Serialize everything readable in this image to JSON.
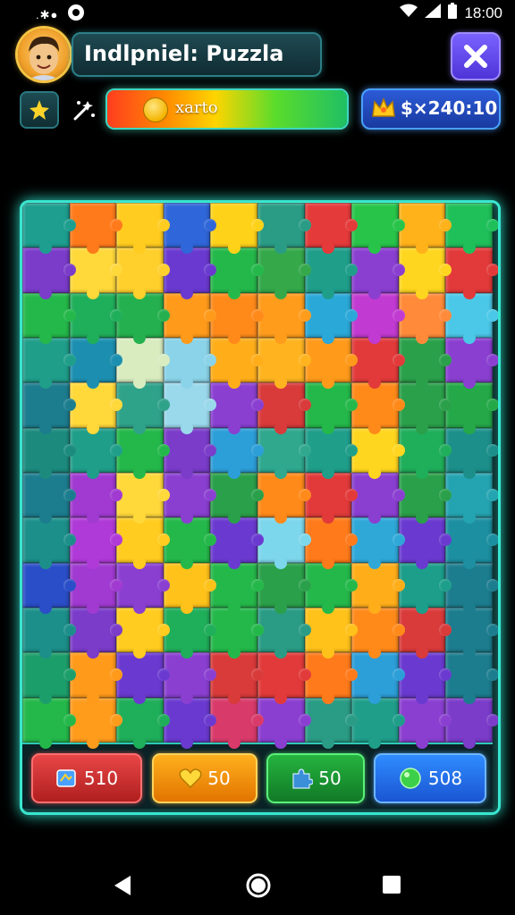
{
  "status_bar": {
    "time": "18:00",
    "left_icons": [
      "notification-dots-icon",
      "app-notification-icon"
    ],
    "right_icons": [
      "wifi-icon",
      "signal-icon",
      "battery-icon"
    ]
  },
  "header": {
    "title": "Indlpniel: Puzzla",
    "avatar": "player-avatar",
    "close_icon": "close-icon"
  },
  "toolbar": {
    "shuffle_icon": "star-sparkle-icon",
    "hint_icon": "sparkle-wand-icon",
    "progress_label": "xarto",
    "progress_fraction": 1.0,
    "score": "$×240:10",
    "score_icon": "gold-crown-icon"
  },
  "board": {
    "rows": 12,
    "columns": 10,
    "piece_colors": [
      [
        "#1d9e8f",
        "#ff7a1a",
        "#ffcc1f",
        "#2f66d9",
        "#ffd21a",
        "#2a9c85",
        "#e43a3a",
        "#28c44a",
        "#ffb21a",
        "#1fbf5a"
      ],
      [
        "#7a3cc9",
        "#ffd83a",
        "#ffcf2c",
        "#6a3ad0",
        "#24b84a",
        "#35a84a",
        "#1f9e8a",
        "#8a3fd1",
        "#ffd61f",
        "#e23a3a"
      ],
      [
        "#24b84a",
        "#1fae5a",
        "#24b04e",
        "#ff9a1a",
        "#ff8a1a",
        "#ff9c1c",
        "#2aa8d8",
        "#c13ad1",
        "#ff8b3a",
        "#4bc8e8"
      ],
      [
        "#1f9e8a",
        "#1c8fb0",
        "#d8ecc0",
        "#8ad3e8",
        "#ffae1a",
        "#ffb41f",
        "#ff9a1a",
        "#e23a3a",
        "#2aa04a",
        "#8a3fd1"
      ],
      [
        "#1c7d8e",
        "#ffd83a",
        "#2fa28a",
        "#9ad8ec",
        "#8a3fd1",
        "#d93a3a",
        "#24b84a",
        "#ff8a1a",
        "#2aa04a",
        "#24a848"
      ],
      [
        "#1c8b7e",
        "#1f9e8a",
        "#24b84a",
        "#7a3cc9",
        "#2c9ed8",
        "#2fa88e",
        "#1f9e8a",
        "#ffd61f",
        "#1fae5a",
        "#1c8f8a"
      ],
      [
        "#1c7d8e",
        "#a03ad1",
        "#ffd83a",
        "#8a3fd1",
        "#2aa04a",
        "#ff8a1a",
        "#e23a3a",
        "#8a3fd1",
        "#2aa04a",
        "#24a4b0"
      ],
      [
        "#1c8f8a",
        "#b03ad8",
        "#ffcc1f",
        "#24b84a",
        "#6a3ad0",
        "#7dd7ec",
        "#ff7a1a",
        "#2fa8d8",
        "#6a3ad0",
        "#1c8fa0"
      ],
      [
        "#2a4ec8",
        "#a03ad1",
        "#8a3fd1",
        "#ffc21a",
        "#24b84a",
        "#2aa04a",
        "#24b84a",
        "#ffae1a",
        "#1c9e8a",
        "#1c7d8e"
      ],
      [
        "#1c8f8a",
        "#7a3cc9",
        "#ffcc1f",
        "#1fae5a",
        "#24b84a",
        "#2a9c85",
        "#ffc21a",
        "#ff8a1a",
        "#d93a3a",
        "#1c7d8e"
      ],
      [
        "#1c9e6a",
        "#ff9a1a",
        "#6a3ad0",
        "#8a3fd1",
        "#d93a3a",
        "#e23a3a",
        "#ff7a1a",
        "#2c9ed8",
        "#6a3ad0",
        "#1c7d8e"
      ],
      [
        "#24b84a",
        "#ff9c1c",
        "#1fae5a",
        "#6a3ad0",
        "#d83a6a",
        "#8a3fd1",
        "#2a9c85",
        "#1f9e8a",
        "#8a3fd1",
        "#7a3cc9"
      ]
    ]
  },
  "tray": {
    "buttons": [
      {
        "label": "510",
        "icon": "puzzle-map-icon",
        "color": "#e23a3a"
      },
      {
        "label": "50",
        "icon": "heart-icon",
        "color": "#ffae1a"
      },
      {
        "label": "50",
        "icon": "puzzle-piece-icon",
        "color": "#24b84a"
      },
      {
        "label": "508",
        "icon": "green-orb-icon",
        "color": "#2f8cff"
      }
    ]
  },
  "nav_bar": {
    "back_icon": "back-triangle-icon",
    "home_icon": "home-circle-icon",
    "recents_icon": "recents-square-icon"
  }
}
